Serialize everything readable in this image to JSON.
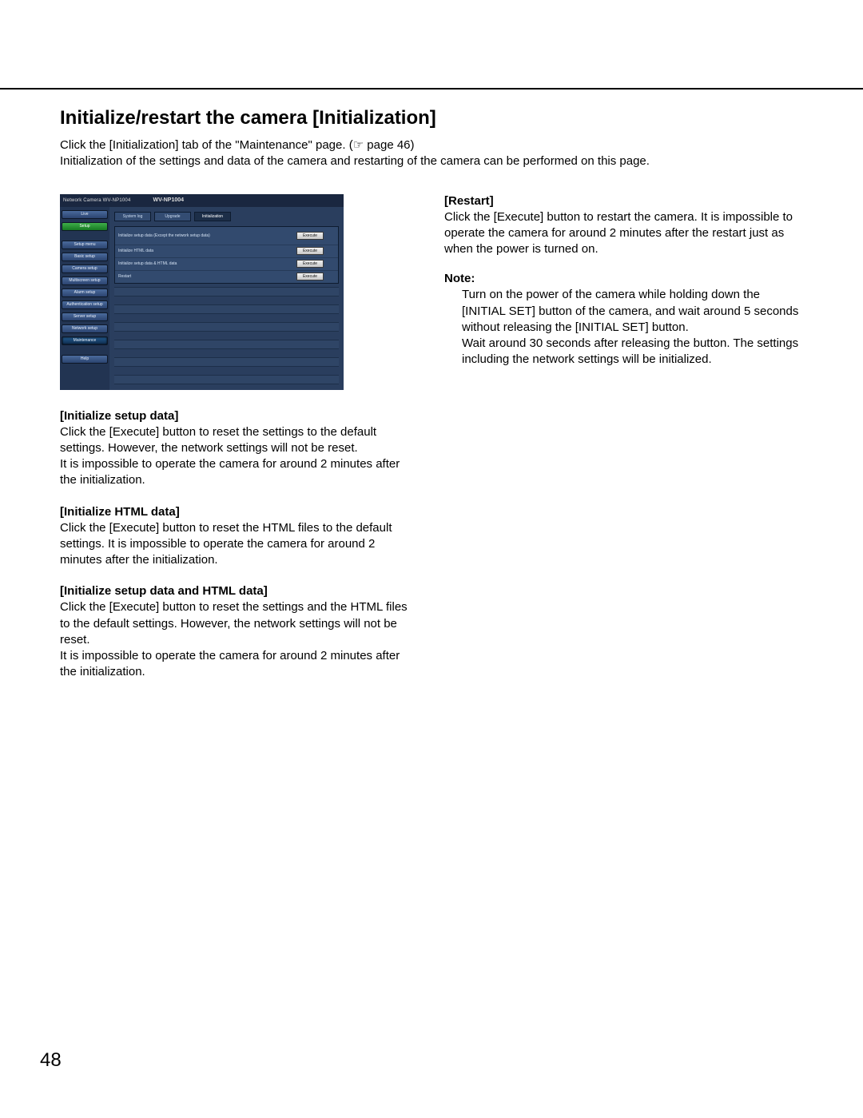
{
  "page_number": "48",
  "title": "Initialize/restart the camera [Initialization]",
  "intro_line1": "Click the [Initialization] tab of the \"Maintenance\" page. (☞ page 46)",
  "intro_line2": "Initialization of the settings and data of the camera and restarting of the camera can be performed on this page.",
  "screenshot": {
    "brand": "Network Camera WV-NP1004",
    "model": "WV-NP1004",
    "sidebar": {
      "live": "Live",
      "setup": "Setup",
      "menu": "Setup menu",
      "basic": "Basic setup",
      "camera": "Camera setup",
      "multi": "Multiscreen setup",
      "alarm": "Alarm setup",
      "auth": "Authentication setup",
      "server": "Server setup",
      "network": "Network setup",
      "maint": "Maintenance",
      "help": "Help"
    },
    "tabs": {
      "log": "System log",
      "upgrade": "Upgrade",
      "init": "Initialization"
    },
    "rows": {
      "r1": "Initialize setup data\n(Except the network setup data)",
      "r2": "Initialize HTML data",
      "r3": "Initialize setup data & HTML data",
      "r4": "Restart"
    },
    "execute": "Execute"
  },
  "left_items": {
    "a_title": "[Initialize setup data]",
    "a_body1": "Click the [Execute] button to reset the settings to the default settings. However, the network settings will not be reset.",
    "a_body2": "It is impossible to operate the camera for around 2 minutes after the initialization.",
    "b_title": "[Initialize HTML data]",
    "b_body1": "Click the [Execute] button to reset the HTML files to the default settings. It is impossible to operate the camera for around 2 minutes after the initialization.",
    "c_title": "[Initialize setup data and HTML data]",
    "c_body1": "Click the [Execute] button to reset the settings and the HTML files to the default settings. However, the network settings will not be reset.",
    "c_body2": "It is impossible to operate the camera for around 2 minutes after the initialization."
  },
  "right": {
    "restart_title": "[Restart]",
    "restart_body": "Click the [Execute] button to restart the camera. It is impossible to operate the camera for around 2 minutes after the restart just as when the power is turned on.",
    "note_title": "Note:",
    "note_body1": "Turn on the power of the camera while holding down the [INITIAL SET] button of the camera, and wait around 5 seconds without releasing the [INITIAL SET] button.",
    "note_body2": "Wait around 30 seconds after releasing the button. The settings including the network settings will be initialized."
  }
}
